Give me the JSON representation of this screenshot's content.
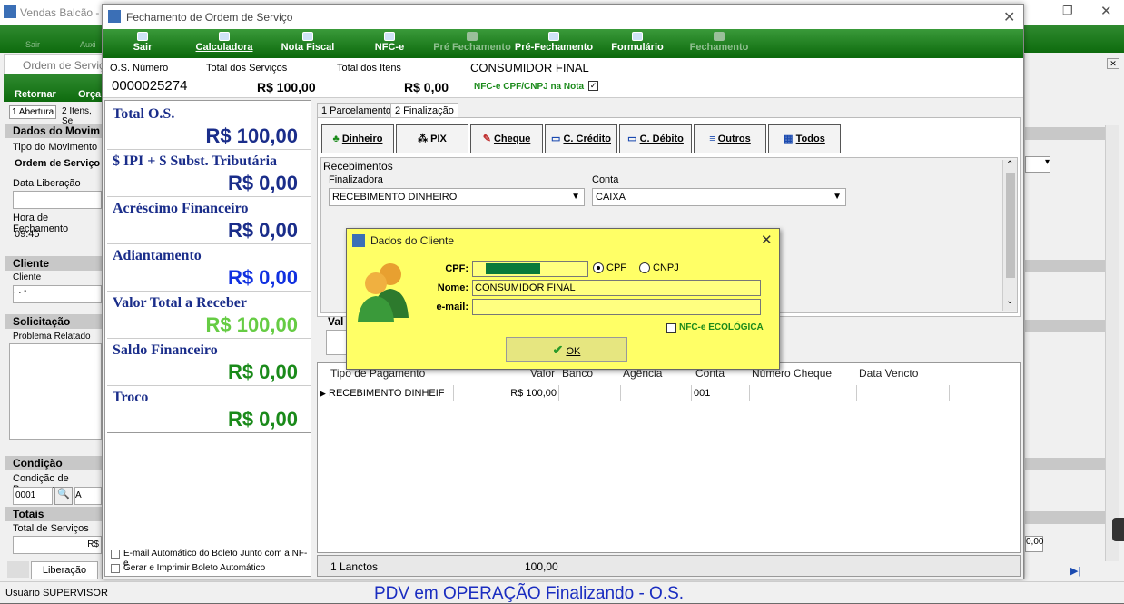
{
  "background_app": {
    "title": "Vendas Balcão - Fre",
    "toolbar": [
      "Sair",
      "Auxi"
    ],
    "sub_window_title": "Ordem de Serviço",
    "sub_toolbar": [
      "Retornar",
      "Orça"
    ],
    "tabs": [
      "1 Abertura",
      "2 Itens, Se"
    ],
    "sections": {
      "movimento": "Dados do Movim",
      "tipo_movimento_label": "Tipo do Movimento",
      "tipo_movimento_value": "Ordem de Serviço",
      "data_liberacao_label": "Data Liberação",
      "hora_fechamento_label": "Hora de Fechamento",
      "hora_fechamento_value": "09:45",
      "cliente": "Cliente",
      "cliente_label": "Cliente",
      "cliente_value": " .  .  -",
      "solicitacao": "Solicitação",
      "problema_label": "Problema Relatado",
      "condicao": "Condição",
      "condicao_label": "Condição de Pagamen",
      "condicao_code": "0001",
      "condicao_value": "A Vista",
      "totais": "Totais",
      "total_servicos_label": "Total de Serviços",
      "total_servicos_value": "R$",
      "liberacao_tab": "Liberação",
      "right_value": "0,00"
    },
    "status_user": "Usuário SUPERVISOR",
    "status_banner": "PDV em OPERAÇÃO Finalizando - O.S."
  },
  "window": {
    "title": "Fechamento de Ordem de Serviço",
    "toolbar": [
      {
        "label": "Sair",
        "enabled": true
      },
      {
        "label": "Calculadora",
        "enabled": true
      },
      {
        "label": "Nota Fiscal",
        "enabled": true
      },
      {
        "label": "NFC-e",
        "enabled": true
      },
      {
        "label": "Pré Fechamento",
        "enabled": false
      },
      {
        "label": "Pré-Fechamento",
        "enabled": true
      },
      {
        "label": "Formulário",
        "enabled": true
      },
      {
        "label": "Fechamento",
        "enabled": false
      }
    ],
    "info": {
      "os_numero_label": "O.S. Número",
      "os_numero": "0000025274",
      "total_servicos_label": "Total dos Serviços",
      "total_servicos": "R$ 100,00",
      "total_itens_label": "Total dos Itens",
      "total_itens": "R$ 0,00",
      "cliente": "CONSUMIDOR FINAL",
      "nfce_cpf_label": "NFC-e CPF/CNPJ na Nota"
    },
    "totals": [
      {
        "label": "Total O.S.",
        "value": "R$ 100,00",
        "color": "#1a2d8a"
      },
      {
        "label": "$ IPI + $ Subst. Tributária",
        "value": "R$ 0,00",
        "color": "#1a2d8a"
      },
      {
        "label": "Acréscimo Financeiro",
        "value": "R$ 0,00",
        "color": "#1a2d8a"
      },
      {
        "label": "Adiantamento",
        "value": "R$ 0,00",
        "color": "#1030e0"
      },
      {
        "label": "Valor Total a Receber",
        "value": "R$ 100,00",
        "color": "#66cc44"
      },
      {
        "label": "Saldo Financeiro",
        "value": "R$ 0,00",
        "color": "#1a8a1a"
      },
      {
        "label": "Troco",
        "value": "R$ 0,00",
        "color": "#1a8a1a"
      }
    ],
    "left_checks": [
      "E-mail Automático do Boleto Junto com a NF-e",
      "Gerar e Imprimir Boleto Automático"
    ],
    "tabs": [
      "1 Parcelamentos",
      "2 Finalização"
    ],
    "payment_buttons": [
      "Dinheiro",
      "PIX",
      "Cheque",
      "C. Crédito",
      "C. Débito",
      "Outros",
      "Todos"
    ],
    "recebimentos": {
      "title": "Recebimentos",
      "finalizadora_label": "Finalizadora",
      "finalizadora_value": "RECEBIMENTO DINHEIRO",
      "conta_label": "Conta",
      "conta_value": "CAIXA"
    },
    "valor_label": "Val",
    "grid": {
      "headers": [
        "Tipo de Pagamento",
        "Valor",
        "Banco",
        "Agência",
        "Conta",
        "Número Cheque",
        "Data Vencto"
      ],
      "rows": [
        [
          "RECEBIMENTO DINHEIF",
          "R$ 100,00",
          "",
          "",
          "001",
          "",
          ""
        ]
      ]
    },
    "footer": {
      "lancamentos": "1 Lanctos",
      "total": "100,00"
    }
  },
  "dialog": {
    "title": "Dados do Cliente",
    "cpf_label": "CPF:",
    "cpf_value": "",
    "cpf_option": "CPF",
    "cnpj_option": "CNPJ",
    "nome_label": "Nome:",
    "nome_value": "CONSUMIDOR FINAL",
    "email_label": "e-mail:",
    "email_value": "",
    "nfce_ecologica": "NFC-e ECOLÓGICA",
    "ok_label": "OK"
  }
}
